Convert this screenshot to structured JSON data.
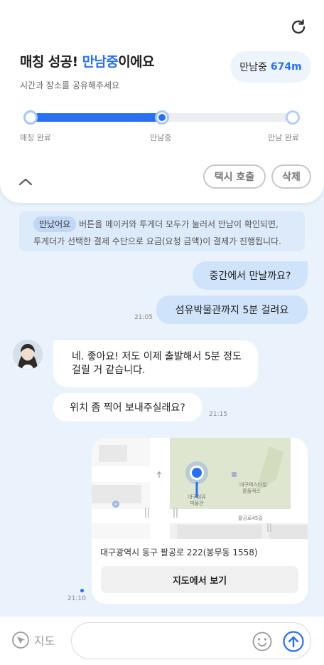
{
  "header": {
    "title_prefix": "매칭 성공! ",
    "title_highlight": "만남중",
    "title_suffix": "이에요",
    "subtitle": "시간과 장소를 공유해주세요",
    "distance_label": "만남중",
    "distance_value": "674m",
    "actions": {
      "call_taxi": "택시 호출",
      "delete": "삭제"
    }
  },
  "progress": {
    "steps": [
      "매칭 완료",
      "만남중",
      "만남 완료"
    ],
    "current_step_index": 1
  },
  "notice": {
    "chip": "만났어요",
    "line1": "버튼을 메이커와 투게더 모두가 눌러서 만남이 확인되면,",
    "line2": "투게더가 선택한 결제 수단으로 요금(요청 금액)이 결제가 진행됩니다."
  },
  "messages": {
    "m1": "중간에서 만날까요?",
    "m2": "섬유박물관까지 5분 걸려요",
    "m2_time": "21:05",
    "r1_line1": "네. 좋아요! 저도 이제 출발해서 5분 정도",
    "r1_line2": "걸릴 거 같습니다.",
    "r2": "위치 좀 찍어 보내주실래요?",
    "r2_time": "21:15",
    "map_time": "21:10"
  },
  "map_card": {
    "place_label_1": "대구섬유",
    "place_label_2": "박물관",
    "poi_label_1": "대구텍스타일",
    "poi_label_2": "콤플렉스",
    "road_label": "팔공로45길",
    "address": "대구광역시 동구 팔공로 222(봉무동 1558)",
    "button": "지도에서 보기"
  },
  "composer": {
    "map_toggle": "지도",
    "placeholder": ""
  },
  "colors": {
    "accent": "#2a6ff0",
    "bubble_mine": "#cfe3fb",
    "background": "#eaf3fc"
  }
}
